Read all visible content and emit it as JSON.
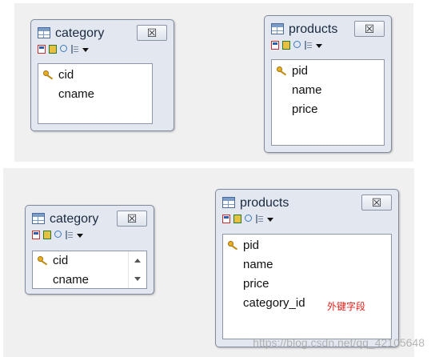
{
  "top": {
    "category": {
      "title": "category",
      "close": "☒",
      "fields": [
        {
          "name": "cid",
          "pk": true
        },
        {
          "name": "cname",
          "pk": false
        }
      ]
    },
    "products": {
      "title": "products",
      "close": "☒",
      "fields": [
        {
          "name": "pid",
          "pk": true
        },
        {
          "name": "name",
          "pk": false
        },
        {
          "name": "price",
          "pk": false
        }
      ]
    }
  },
  "bottom": {
    "category": {
      "title": "category",
      "close": "☒",
      "fields": [
        {
          "name": "cid",
          "pk": true
        },
        {
          "name": "cname",
          "pk": false
        }
      ]
    },
    "products": {
      "title": "products",
      "close": "☒",
      "fields": [
        {
          "name": "pid",
          "pk": true
        },
        {
          "name": "name",
          "pk": false
        },
        {
          "name": "price",
          "pk": false
        },
        {
          "name": "category_id",
          "pk": false
        }
      ]
    },
    "fk_note": "外键字段"
  },
  "watermark": "https://blog.csdn.net/qq_42105648"
}
